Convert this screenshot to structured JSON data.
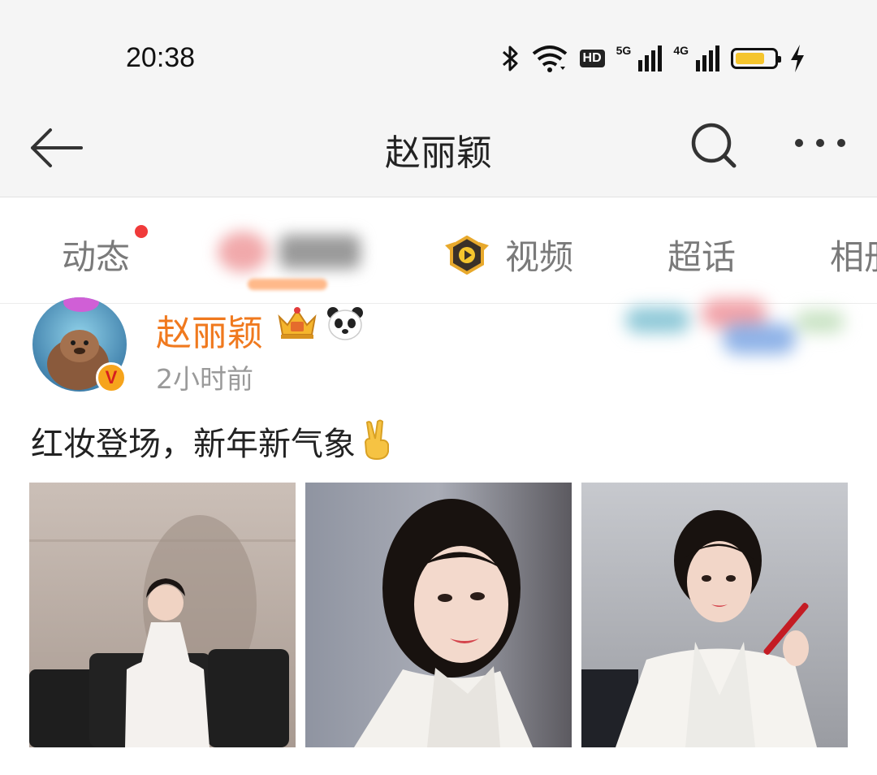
{
  "status_bar": {
    "time": "20:38",
    "hd_label": "HD",
    "network_1": "5G",
    "network_2": "4G",
    "battery_level": 0.75,
    "battery_color": "#f5c52d"
  },
  "nav": {
    "title": "赵丽颖",
    "back_icon": "arrow-left-icon",
    "search_icon": "search-icon",
    "more_icon": "more-icon"
  },
  "tabs": [
    {
      "label": "动态",
      "has_red_dot": true
    },
    {
      "label": "",
      "blurred": true
    },
    {
      "label": "视频",
      "icon": "video-badge-icon"
    },
    {
      "label": "超话"
    },
    {
      "label": "相册"
    }
  ],
  "post": {
    "author": "赵丽颖",
    "author_color": "#f0791e",
    "verified_badge": "V",
    "timestamp": "2小时前",
    "text": "红妆登场，新年新气象",
    "emoji": "victory-hand-icon",
    "photos": [
      "photo-1",
      "photo-2",
      "photo-3"
    ]
  }
}
